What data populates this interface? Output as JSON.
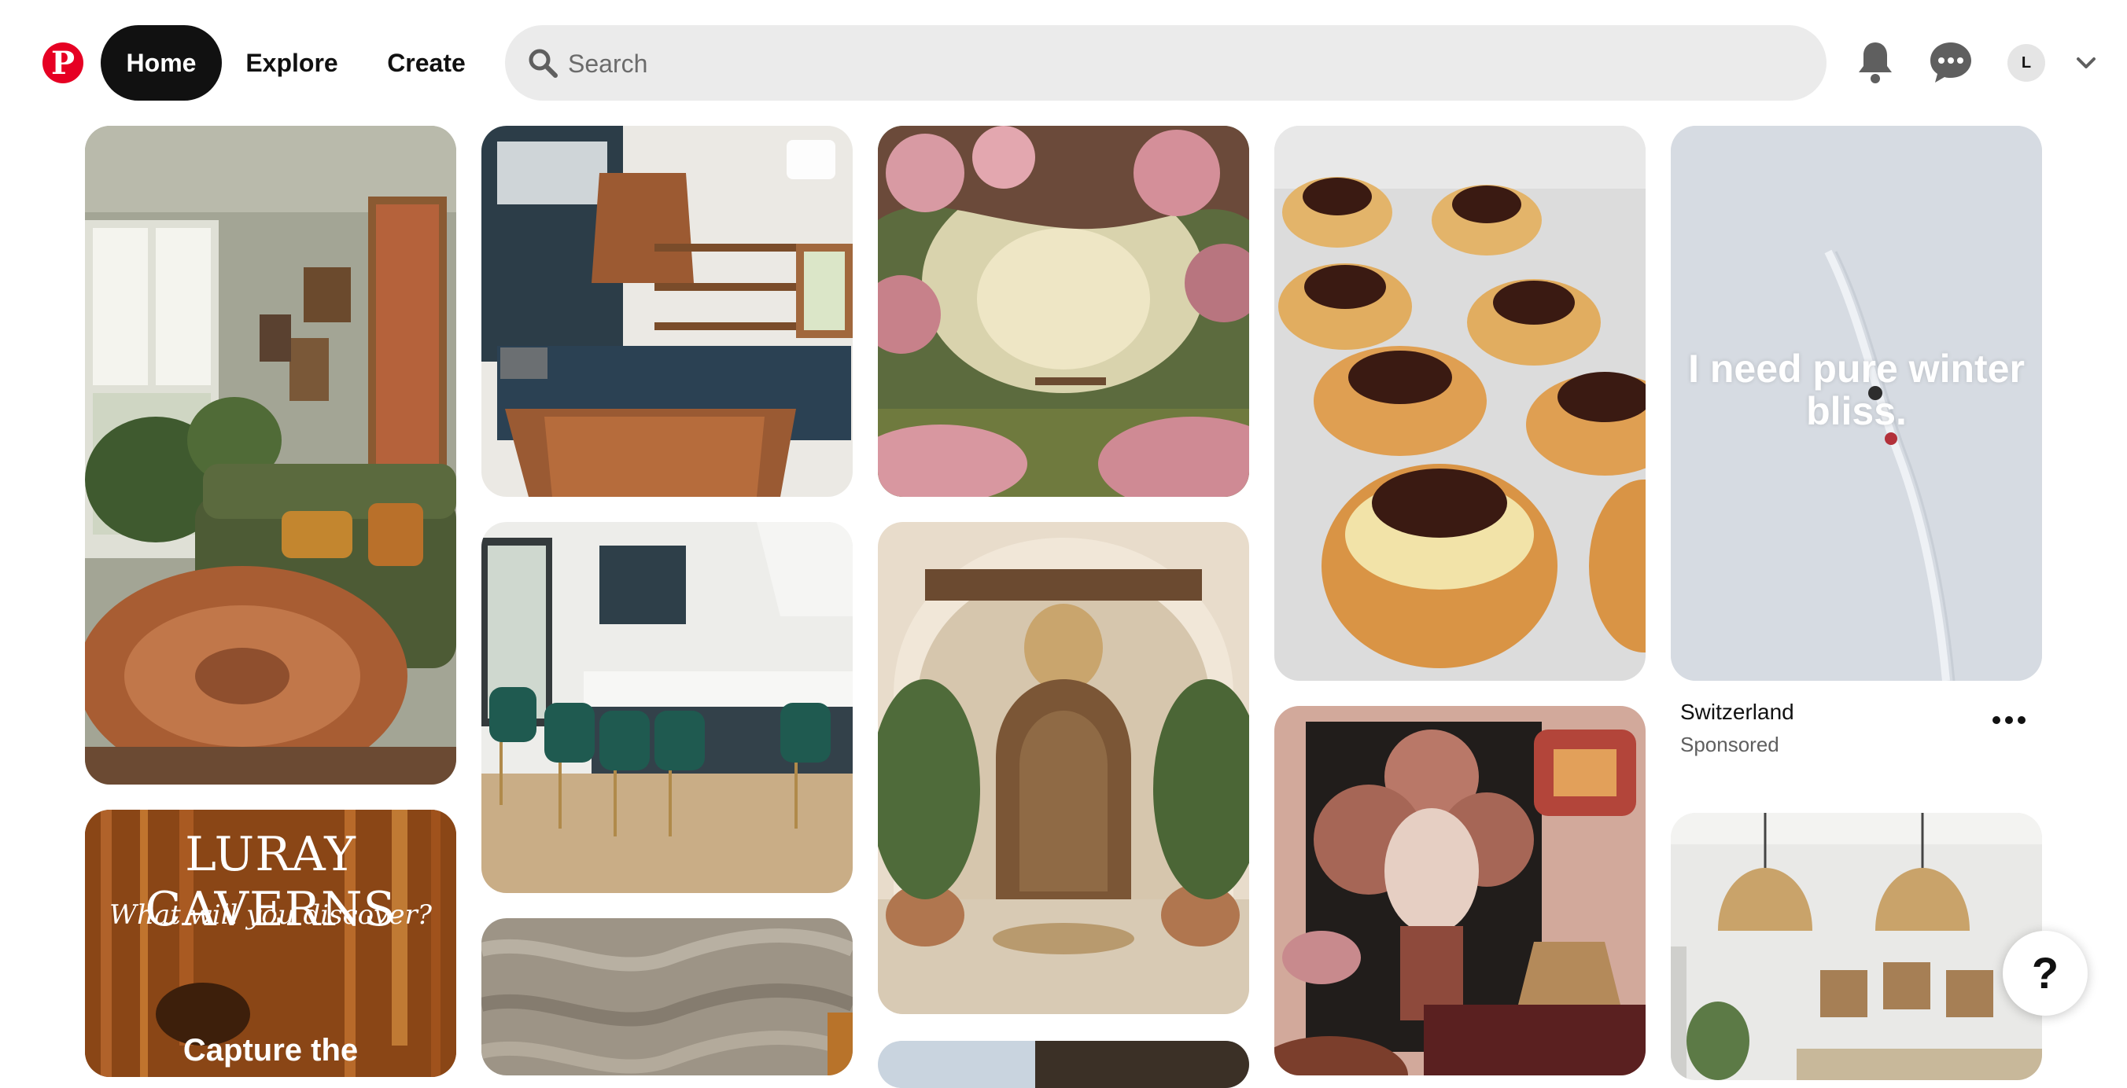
{
  "header": {
    "logo_letter": "P",
    "nav": {
      "home": "Home",
      "explore": "Explore",
      "create": "Create"
    },
    "search": {
      "placeholder": "Search",
      "value": ""
    },
    "avatar_initial": "L",
    "icons": [
      "pinterest-logo",
      "search-icon",
      "bell-icon",
      "messages-icon",
      "chevron-down-icon"
    ]
  },
  "pins": {
    "swiss_overlay": "I need pure winter bliss.",
    "caverns": {
      "title": "LURAY CAVERNS",
      "subtitle": "What will you discover?",
      "cta": "Capture the"
    },
    "sponsored": {
      "title": "Switzerland",
      "label": "Sponsored"
    }
  },
  "help_label": "?",
  "colors": {
    "brand": "#e60023",
    "active_nav": "#111111",
    "search_bg": "#ebebeb"
  }
}
